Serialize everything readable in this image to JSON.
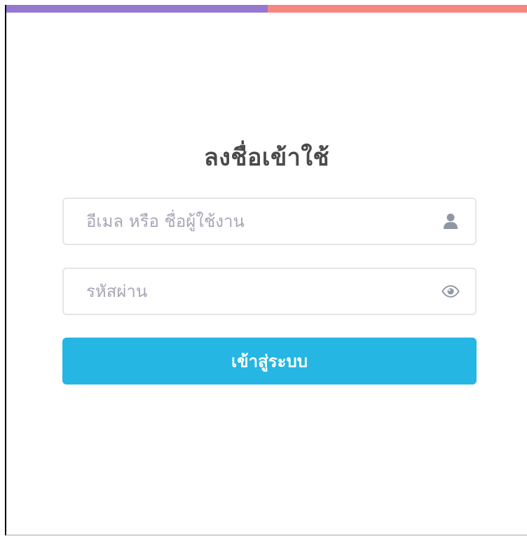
{
  "colors": {
    "topbar_left": "#9677d1",
    "topbar_right": "#f7867e",
    "button_bg": "#25b6e3",
    "icon": "#8f97a3"
  },
  "login": {
    "title": "ลงชื่อเข้าใช้",
    "email_placeholder": "อีเมล หรือ ชื่อผู้ใช้งาน",
    "email_icon": "user-icon",
    "password_placeholder": "รหัสผ่าน",
    "password_icon": "eye-icon",
    "submit_label": "เข้าสู่ระบบ"
  }
}
